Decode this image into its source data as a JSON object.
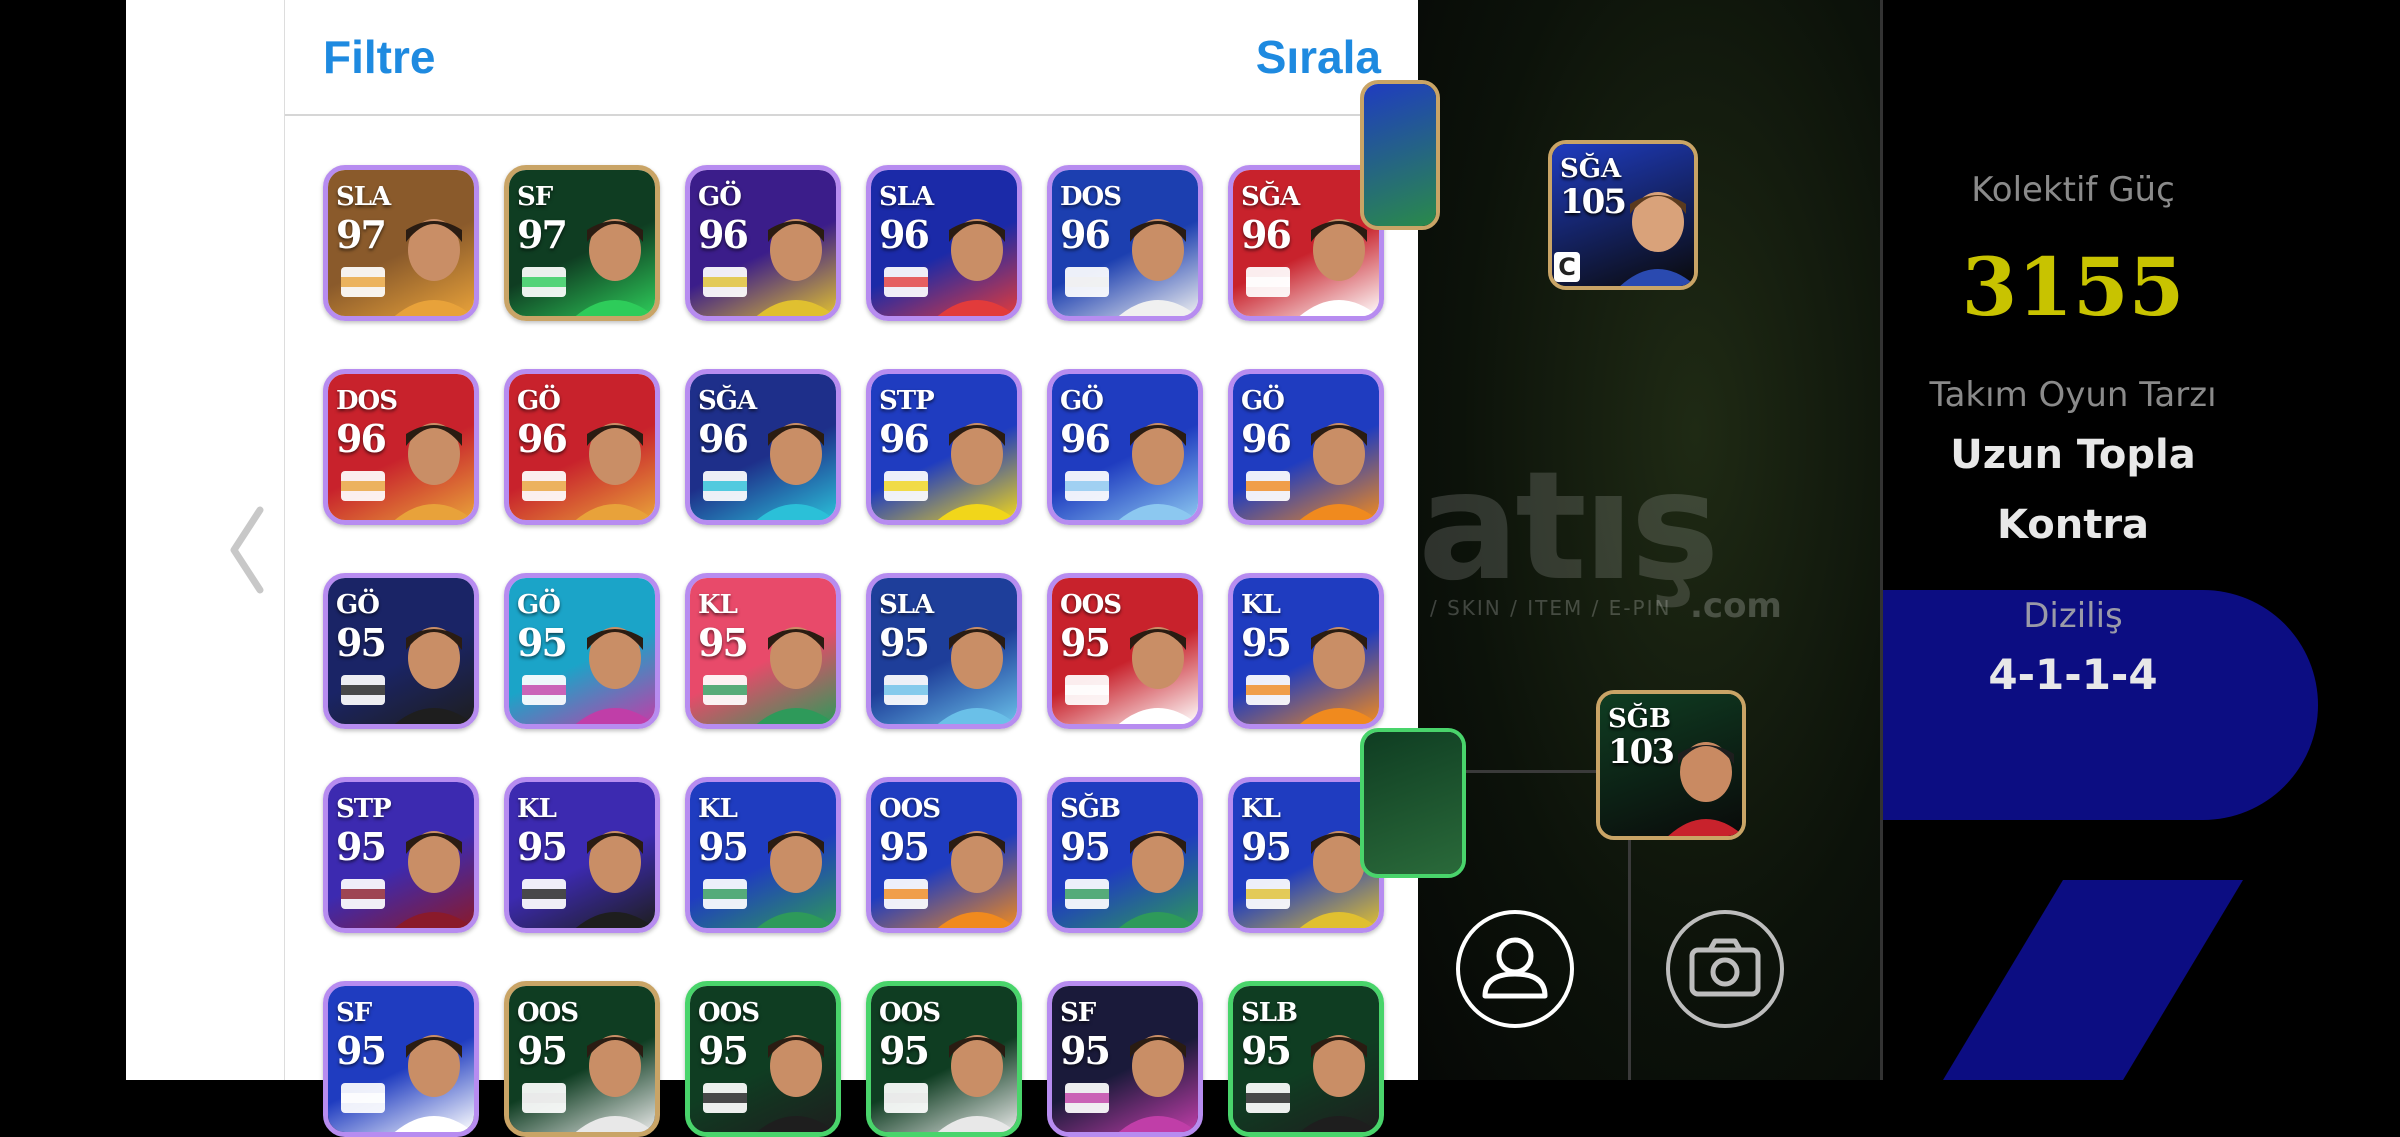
{
  "panel": {
    "filter_label": "Filtre",
    "sort_label": "Sırala"
  },
  "cards": [
    {
      "pos": "SLA",
      "rating": "97",
      "bg": "#8a5a2b",
      "accent": "#e8a23a",
      "border": "purple",
      "badge": "club-crest-icon"
    },
    {
      "pos": "SF",
      "rating": "97",
      "bg": "#0f3d22",
      "accent": "#2ecc5a",
      "border": "gold",
      "badge": "flag-spain-icon"
    },
    {
      "pos": "GÖ",
      "rating": "96",
      "bg": "#3b1d8a",
      "accent": "#e0c030",
      "border": "purple",
      "badge": "club-crest-icon"
    },
    {
      "pos": "SLA",
      "rating": "96",
      "bg": "#1b2aa8",
      "accent": "#e23b3b",
      "border": "purple",
      "badge": "flag-spain-icon"
    },
    {
      "pos": "DOS",
      "rating": "96",
      "bg": "#1c3fb0",
      "accent": "#f0f0f0",
      "border": "purple",
      "badge": "flag-england-icon"
    },
    {
      "pos": "SĞA",
      "rating": "96",
      "bg": "#c8222c",
      "accent": "#ffffff",
      "border": "purple",
      "badge": "club-crest-icon"
    },
    {
      "pos": "DOS",
      "rating": "96",
      "bg": "#c8222c",
      "accent": "#e8a23a",
      "border": "purple",
      "badge": "club-crest-icon"
    },
    {
      "pos": "GÖ",
      "rating": "96",
      "bg": "#c8222c",
      "accent": "#e8a23a",
      "border": "purple",
      "badge": "club-crest-icon"
    },
    {
      "pos": "SĞA",
      "rating": "96",
      "bg": "#1e2f8a",
      "accent": "#2bc0d8",
      "border": "purple",
      "badge": "flag-egypt-icon"
    },
    {
      "pos": "STP",
      "rating": "96",
      "bg": "#1f3cc0",
      "accent": "#f1d61a",
      "border": "purple",
      "badge": "flag-brazil-icon"
    },
    {
      "pos": "GÖ",
      "rating": "96",
      "bg": "#1f3cc0",
      "accent": "#8cc8f0",
      "border": "purple",
      "badge": "flag-argentina-icon"
    },
    {
      "pos": "GÖ",
      "rating": "96",
      "bg": "#1f3cc0",
      "accent": "#f08a1e",
      "border": "purple",
      "badge": "flag-netherlands-icon"
    },
    {
      "pos": "GÖ",
      "rating": "95",
      "bg": "#1a2466",
      "accent": "#1e1e1e",
      "border": "purple",
      "badge": "club-crest-icon"
    },
    {
      "pos": "GÖ",
      "rating": "95",
      "bg": "#1ba4c8",
      "accent": "#c03ea8",
      "border": "purple",
      "badge": "flag-uruguay-icon"
    },
    {
      "pos": "KL",
      "rating": "95",
      "bg": "#e84a6a",
      "accent": "#2e9a5a",
      "border": "purple",
      "badge": "club-crest-icon"
    },
    {
      "pos": "SLA",
      "rating": "95",
      "bg": "#1e3e9a",
      "accent": "#6ac0e8",
      "border": "purple",
      "badge": "club-crest-icon"
    },
    {
      "pos": "OOS",
      "rating": "95",
      "bg": "#c8222c",
      "accent": "#ffffff",
      "border": "purple",
      "badge": "club-crest-icon"
    },
    {
      "pos": "KL",
      "rating": "95",
      "bg": "#1f3cc0",
      "accent": "#f08a1e",
      "border": "purple",
      "badge": "flag-slovenia-icon"
    },
    {
      "pos": "STP",
      "rating": "95",
      "bg": "#3c2ab0",
      "accent": "#8a1a2a",
      "border": "purple",
      "badge": "club-crest-icon"
    },
    {
      "pos": "KL",
      "rating": "95",
      "bg": "#3c2ab0",
      "accent": "#1e1e1e",
      "border": "purple",
      "badge": "club-crest-icon"
    },
    {
      "pos": "KL",
      "rating": "95",
      "bg": "#1f3cc0",
      "accent": "#2e9a5a",
      "border": "purple",
      "badge": "club-crest-icon"
    },
    {
      "pos": "OOS",
      "rating": "95",
      "bg": "#1f3cc0",
      "accent": "#f08a1e",
      "border": "purple",
      "badge": "flag-netherlands-icon"
    },
    {
      "pos": "SĞB",
      "rating": "95",
      "bg": "#1f3cc0",
      "accent": "#2e9a5a",
      "border": "purple",
      "badge": "flag-morocco-icon"
    },
    {
      "pos": "KL",
      "rating": "95",
      "bg": "#1f3cc0",
      "accent": "#e0c030",
      "border": "purple",
      "badge": "flag-italy-icon"
    },
    {
      "pos": "SF",
      "rating": "95",
      "bg": "#1f3cc0",
      "accent": "#ffffff",
      "border": "purple",
      "badge": "club-crest-icon"
    },
    {
      "pos": "OOS",
      "rating": "95",
      "bg": "#0f3d22",
      "accent": "#e8e8e8",
      "border": "gold",
      "badge": "club-crest-icon"
    },
    {
      "pos": "OOS",
      "rating": "95",
      "bg": "#0f3d22",
      "accent": "#1e1e1e",
      "border": "green",
      "badge": "club-crest-icon"
    },
    {
      "pos": "OOS",
      "rating": "95",
      "bg": "#0f3d22",
      "accent": "#e8e8e8",
      "border": "green",
      "badge": "club-crest-icon"
    },
    {
      "pos": "SF",
      "rating": "95",
      "bg": "#1a1a3a",
      "accent": "#c03ea8",
      "border": "purple",
      "badge": "club-crest-icon"
    },
    {
      "pos": "SLB",
      "rating": "95",
      "bg": "#0f3d22",
      "accent": "#1e1e1e",
      "border": "green",
      "badge": "club-crest-icon"
    }
  ],
  "pitch_cards": [
    {
      "pos": "SĞA",
      "rating": "105",
      "bg": "#1f3cc0",
      "captain": "C"
    },
    {
      "pos": "SĞB",
      "rating": "103",
      "bg": "#0f3d22",
      "captain": ""
    }
  ],
  "watermark": {
    "main": "atış",
    "sub": "/ SKIN / ITEM / E-PIN",
    "com": ".com"
  },
  "sidebar": {
    "kolektif_label": "Kolektif Güç",
    "kolektif_value": "3155",
    "style_label": "Takım Oyun Tarzı",
    "style_value_1": "Uzun Topla",
    "style_value_2": "Kontra",
    "formation_label": "Diziliş",
    "formation_value": "4-1-1-4"
  },
  "icons": {
    "back": "chevron-left-icon",
    "profile": "person-icon",
    "camera": "camera-icon"
  }
}
